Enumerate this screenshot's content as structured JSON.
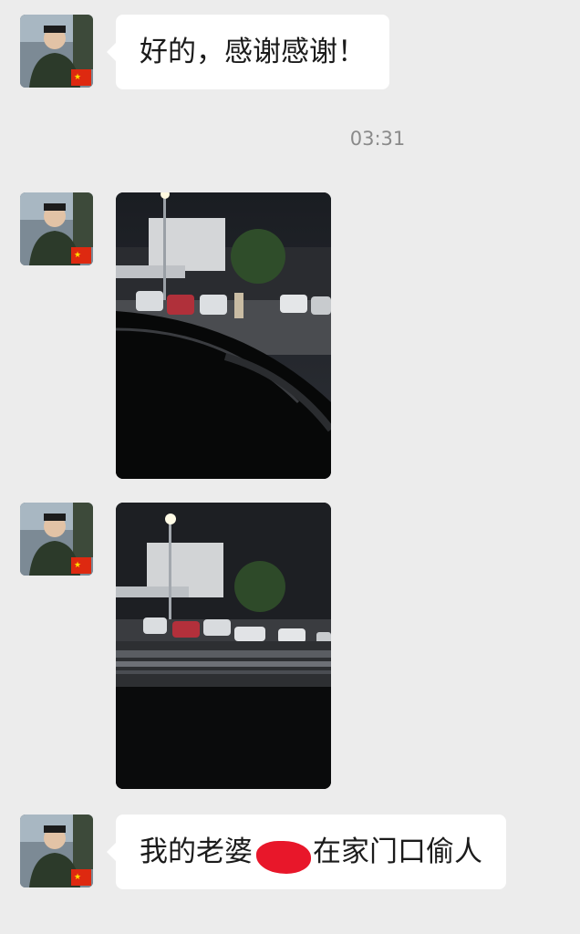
{
  "messages": [
    {
      "type": "text",
      "text": "好的，感谢感谢！"
    },
    {
      "type": "image",
      "description": "night parking lot photo 1"
    },
    {
      "type": "image",
      "description": "night parking lot photo 2"
    },
    {
      "type": "text",
      "text_before": "我的老婆",
      "text_after": "在家门口偷人"
    }
  ],
  "timestamp": "03:31",
  "colors": {
    "background": "#ececec",
    "bubble": "#ffffff",
    "redaction": "#e8172a"
  }
}
